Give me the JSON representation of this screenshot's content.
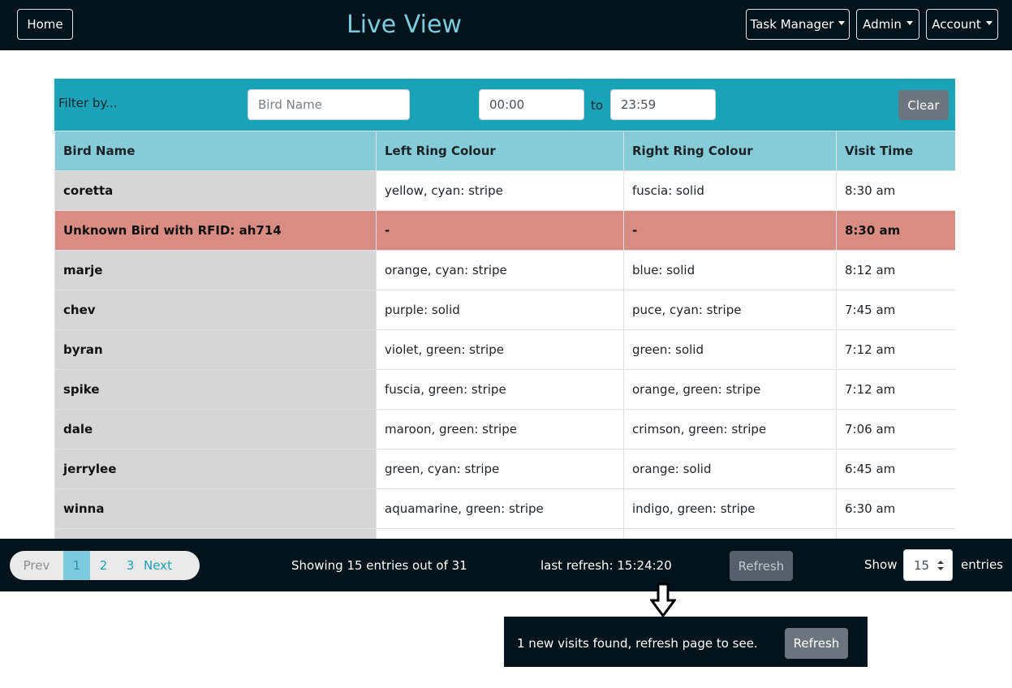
{
  "header": {
    "home_label": "Home",
    "title": "Live View",
    "menus": {
      "task_manager": "Task Manager",
      "admin": "Admin",
      "account": "Account"
    }
  },
  "filter": {
    "label": "Filter by...",
    "bird_name_placeholder": "Bird Name",
    "time_from": "00:00",
    "to_label": "to",
    "time_to": "23:59",
    "clear_label": "Clear"
  },
  "table": {
    "columns": [
      "Bird Name",
      "Left Ring Colour",
      "Right Ring Colour",
      "Visit Time"
    ],
    "rows": [
      [
        "coretta",
        "yellow, cyan: stripe",
        "fuscia: solid",
        "8:30 am"
      ],
      [
        "Unknown Bird with RFID: ah714",
        "-",
        "-",
        "8:30 am"
      ],
      [
        "marje",
        "orange, cyan: stripe",
        "blue: solid",
        "8:12 am"
      ],
      [
        "chev",
        "purple: solid",
        "puce, cyan: stripe",
        "7:45 am"
      ],
      [
        "byran",
        "violet, green: stripe",
        "green: solid",
        "7:12 am"
      ],
      [
        "spike",
        "fuscia, green: stripe",
        "orange, green: stripe",
        "7:12 am"
      ],
      [
        "dale",
        "maroon, green: stripe",
        "crimson, green: stripe",
        "7:06 am"
      ],
      [
        "jerrylee",
        "green, cyan: stripe",
        "orange: solid",
        "6:45 am"
      ],
      [
        "winna",
        "aquamarine, green: stripe",
        "indigo, green: stripe",
        "6:30 am"
      ],
      [
        "",
        "",
        "",
        ""
      ]
    ]
  },
  "footer": {
    "pagination": {
      "prev": "Prev",
      "pages": [
        "1",
        "2",
        "3"
      ],
      "next": "Next"
    },
    "summary": "Showing 15 entries out of 31",
    "last_refresh": "last refresh: 15:24:20",
    "refresh_label": "Refresh",
    "show_label": "Show",
    "entries_value": "15",
    "entries_label": "entries"
  },
  "toast": {
    "message": "1 new visits found, refresh page to see.",
    "refresh_label": "Refresh"
  },
  "colors": {
    "navbar": "#03131b",
    "accent": "#19a2b8",
    "header_row": "#85cbd8",
    "unknown_row": "#d98c82",
    "name_cell": "#d6d6d6"
  }
}
